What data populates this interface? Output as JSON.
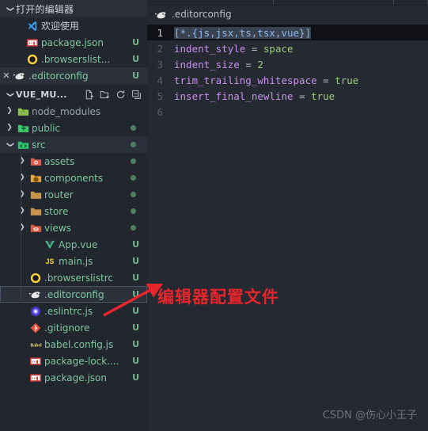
{
  "sidebar": {
    "open_editors": {
      "title": "打开的编辑器",
      "twisty": "chevron-down-icon",
      "items": [
        {
          "name": "欢迎使用",
          "icon": "vscode-logo-icon",
          "badge": "",
          "closable": false,
          "active": false
        },
        {
          "name": "package.json",
          "icon": "npm-icon",
          "badge": "U",
          "closable": false,
          "active": false
        },
        {
          "name": ".browserslist...",
          "icon": "browserslist-icon",
          "badge": "U",
          "closable": false,
          "active": false
        },
        {
          "name": ".editorconfig",
          "icon": "editorconfig-icon",
          "badge": "U",
          "closable": true,
          "active": true
        }
      ]
    },
    "project": {
      "title": "VUE_MU...",
      "twisty": "chevron-down-icon",
      "actions": [
        "new-file-icon",
        "new-folder-icon",
        "refresh-icon",
        "collapse-all-icon"
      ]
    },
    "tree": [
      {
        "label": "node_modules",
        "type": "folder",
        "icon": "folder-node-modules-icon",
        "state": "collapsed",
        "indent": 1,
        "dot": false,
        "badge": "",
        "dim": true
      },
      {
        "label": "public",
        "type": "folder",
        "icon": "folder-public-icon",
        "state": "collapsed",
        "indent": 1,
        "dot": true,
        "badge": "",
        "dim": false
      },
      {
        "label": "src",
        "type": "folder",
        "icon": "folder-src-icon",
        "state": "expanded",
        "indent": 1,
        "dot": true,
        "badge": "",
        "dim": false
      },
      {
        "label": "assets",
        "type": "folder",
        "icon": "folder-assets-icon",
        "state": "collapsed",
        "indent": 2,
        "dot": true,
        "badge": "",
        "dim": false
      },
      {
        "label": "components",
        "type": "folder",
        "icon": "folder-components-icon",
        "state": "collapsed",
        "indent": 2,
        "dot": true,
        "badge": "",
        "dim": false
      },
      {
        "label": "router",
        "type": "folder",
        "icon": "folder-router-icon",
        "state": "collapsed",
        "indent": 2,
        "dot": true,
        "badge": "",
        "dim": false
      },
      {
        "label": "store",
        "type": "folder",
        "icon": "folder-store-icon",
        "state": "collapsed",
        "indent": 2,
        "dot": true,
        "badge": "",
        "dim": false
      },
      {
        "label": "views",
        "type": "folder",
        "icon": "folder-views-icon",
        "state": "collapsed",
        "indent": 2,
        "dot": true,
        "badge": "",
        "dim": false
      },
      {
        "label": "App.vue",
        "type": "file",
        "icon": "vue-icon",
        "state": "none",
        "indent": 3,
        "dot": false,
        "badge": "U",
        "dim": false
      },
      {
        "label": "main.js",
        "type": "file",
        "icon": "js-icon",
        "state": "none",
        "indent": 3,
        "dot": false,
        "badge": "U",
        "dim": false
      },
      {
        "label": ".browserslistrc",
        "type": "file",
        "icon": "browserslist-icon",
        "state": "none",
        "indent": 2,
        "dot": false,
        "badge": "U",
        "dim": false
      },
      {
        "label": ".editorconfig",
        "type": "file",
        "icon": "editorconfig-icon",
        "state": "none",
        "indent": 2,
        "dot": false,
        "badge": "U",
        "dim": false,
        "selected": true
      },
      {
        "label": ".eslintrc.js",
        "type": "file",
        "icon": "eslint-icon",
        "state": "none",
        "indent": 2,
        "dot": false,
        "badge": "U",
        "dim": false
      },
      {
        "label": ".gitignore",
        "type": "file",
        "icon": "git-icon",
        "state": "none",
        "indent": 2,
        "dot": false,
        "badge": "U",
        "dim": false
      },
      {
        "label": "babel.config.js",
        "type": "file",
        "icon": "babel-icon",
        "state": "none",
        "indent": 2,
        "dot": false,
        "badge": "U",
        "dim": false
      },
      {
        "label": "package-lock....",
        "type": "file",
        "icon": "npm-icon",
        "state": "none",
        "indent": 2,
        "dot": false,
        "badge": "U",
        "dim": false
      },
      {
        "label": "package.json",
        "type": "file",
        "icon": "npm-icon",
        "state": "none",
        "indent": 2,
        "dot": false,
        "badge": "U",
        "dim": false
      }
    ]
  },
  "editor": {
    "breadcrumb": {
      "icon": "editorconfig-icon",
      "label": ".editorconfig"
    },
    "lines": [
      {
        "n": "1",
        "current": true,
        "selected_text": "[*.{js,jsx,ts,tsx,vue}]"
      },
      {
        "n": "2",
        "current": false,
        "key": "indent_style",
        "eq": "=",
        "value": "space"
      },
      {
        "n": "3",
        "current": false,
        "key": "indent_size",
        "eq": "=",
        "value": "2"
      },
      {
        "n": "4",
        "current": false,
        "key": "trim_trailing_whitespace",
        "eq": "=",
        "value": "true"
      },
      {
        "n": "5",
        "current": false,
        "key": "insert_final_newline",
        "eq": "=",
        "value": "true"
      },
      {
        "n": "6",
        "current": false,
        "key": "",
        "eq": "",
        "value": ""
      }
    ]
  },
  "annotation": {
    "text": "编辑器配置文件",
    "color": "#e8252c",
    "arrow": "arrow-pointing-up-right"
  },
  "watermark": "CSDN @伤心小王子",
  "colors": {
    "sidebar_bg": "#22262e",
    "editor_bg": "#252931",
    "filename_green": "#7fc7a0",
    "key_purple": "#c792ea",
    "value_green": "#9ccc7c",
    "string_blue": "#8fb8e8",
    "annotation_red": "#e8252c"
  }
}
